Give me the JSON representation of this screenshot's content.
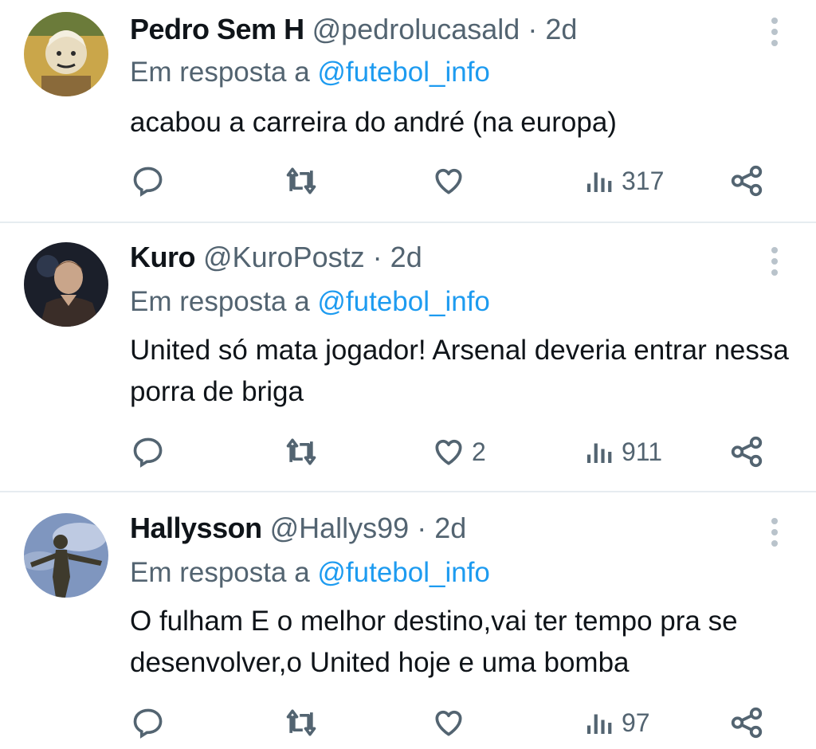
{
  "tweets": [
    {
      "name": "Pedro Sem H",
      "handle": "@pedrolucasald",
      "separator": "·",
      "time": "2d",
      "reply_prefix": "Em resposta a",
      "reply_mention": "@futebol_info",
      "text": "acabou a carreira do andré (na europa)",
      "likes": "",
      "views": "317",
      "avatar_colors": [
        "#caa64a",
        "#6b7b3a",
        "#e8dcc0"
      ]
    },
    {
      "name": "Kuro",
      "handle": "@KuroPostz",
      "separator": "·",
      "time": "2d",
      "reply_prefix": "Em resposta a",
      "reply_mention": "@futebol_info",
      "text": "United só mata jogador! Arsenal deveria entrar nessa porra de briga",
      "likes": "2",
      "views": "911",
      "avatar_colors": [
        "#1b1f2a",
        "#c9a58a",
        "#3a2d28"
      ]
    },
    {
      "name": "Hallysson",
      "handle": "@Hallys99",
      "separator": "·",
      "time": "2d",
      "reply_prefix": "Em resposta a",
      "reply_mention": "@futebol_info",
      "text": "O fulham E o melhor destino,vai ter tempo pra se desenvolver,o United hoje e uma bomba",
      "likes": "",
      "views": "97",
      "avatar_colors": [
        "#7f96bf",
        "#c9d4e8",
        "#3e3a2c"
      ]
    }
  ],
  "colors": {
    "text": "#0f1419",
    "secondary": "#536471",
    "mention": "#1d9bf0",
    "divider": "#e6ecf0"
  },
  "icons": [
    "reply-icon",
    "retweet-icon",
    "like-icon",
    "views-icon",
    "share-icon",
    "more-icon"
  ]
}
